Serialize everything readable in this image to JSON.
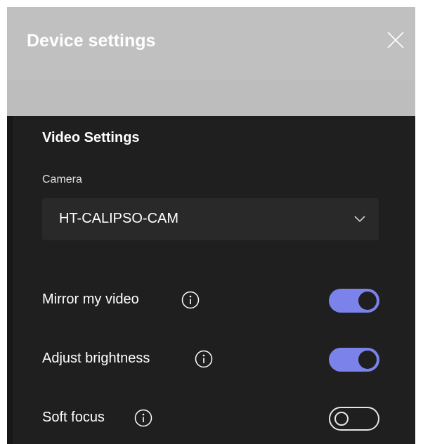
{
  "dialog": {
    "title": "Device settings",
    "close_icon": "close-icon"
  },
  "video_settings": {
    "title": "Video Settings",
    "camera": {
      "label": "Camera",
      "selected": "HT-CALIPSO-CAM",
      "icon": "chevron-down-icon"
    },
    "options": [
      {
        "label": "Mirror my video",
        "enabled": true,
        "info_icon": "info-icon"
      },
      {
        "label": "Adjust brightness",
        "enabled": true,
        "info_icon": "info-icon"
      },
      {
        "label": "Soft focus",
        "enabled": false,
        "info_icon": "info-icon"
      }
    ]
  },
  "colors": {
    "header_bg": "#c0c0c0",
    "panel_bg": "#1f1f1f",
    "dropdown_bg": "#292929",
    "toggle_on": "#7b83eb",
    "text": "#ffffff"
  }
}
